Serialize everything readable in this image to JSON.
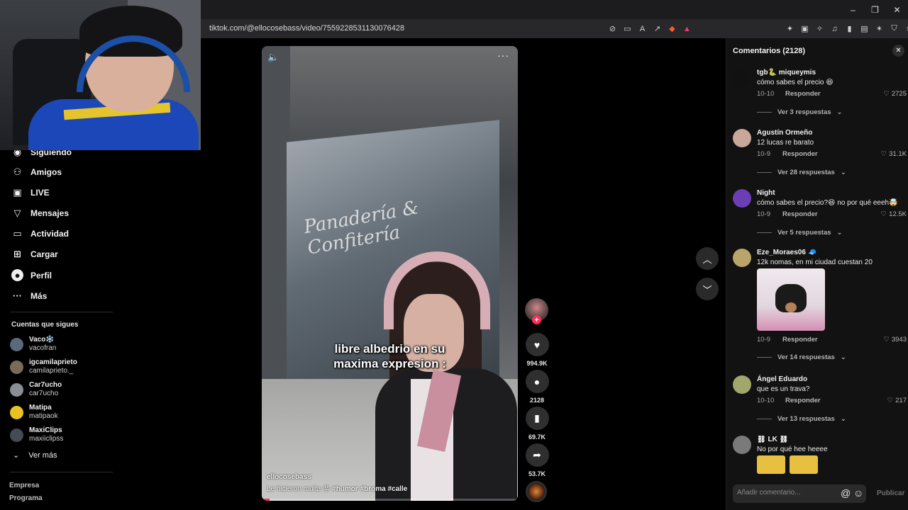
{
  "browser": {
    "url": "tiktok.com/@ellocosebass/video/7559228531130076428",
    "window_controls": {
      "minimize": "–",
      "restore": "❐",
      "close": "✕"
    }
  },
  "sidebar": {
    "nav": [
      {
        "label": "Siguiendo",
        "icon": "following-icon"
      },
      {
        "label": "Amigos",
        "icon": "friends-icon"
      },
      {
        "label": "LIVE",
        "icon": "live-icon"
      },
      {
        "label": "Mensajes",
        "icon": "messages-icon"
      },
      {
        "label": "Actividad",
        "icon": "activity-icon"
      },
      {
        "label": "Cargar",
        "icon": "upload-icon"
      },
      {
        "label": "Perfil",
        "icon": "profile-icon"
      },
      {
        "label": "Más",
        "icon": "more-icon"
      }
    ],
    "following_title": "Cuentas que sigues",
    "following": [
      {
        "name": "Vaco❄️",
        "user": "vacofran",
        "color": "#5a6a7a"
      },
      {
        "name": "igcamilaprieto",
        "user": "camilaprieto._",
        "color": "#7a6a5a"
      },
      {
        "name": "Car7ucho",
        "user": "car7ucho",
        "color": "#8a8f96"
      },
      {
        "name": "Matipa",
        "user": "matipaok",
        "color": "#e8c21e"
      },
      {
        "name": "MaxiClips",
        "user": "maxiiclipss",
        "color": "#444b55"
      }
    ],
    "see_more": "Ver más",
    "footer": [
      "Empresa",
      "Programa"
    ]
  },
  "video": {
    "caption_line1": "libre albedrio en su",
    "caption_line2": "maxima expresion :",
    "author": "ellocosebass",
    "description": "Le hicieron multa 😡",
    "hashtags": [
      "#humor",
      "#broma",
      "#calle"
    ],
    "progress": 0.03
  },
  "actions": {
    "likes": "994.9K",
    "comments": "2128",
    "saves": "69.7K",
    "shares": "53.7K"
  },
  "comments_panel": {
    "title": "Comentarios (2128)",
    "reply_label": "Responder",
    "items": [
      {
        "name": "tgb🐍 miqueymis",
        "text": "cómo sabes el precio 😆",
        "date": "10-10",
        "likes": "2725",
        "replies": "Ver 3 respuestas",
        "avatar": "#111111"
      },
      {
        "name": "Agustín Ormeño",
        "text": "12 lucas re barato",
        "date": "10-9",
        "likes": "31.1K",
        "replies": "Ver 28 respuestas",
        "avatar": "#c9a89a"
      },
      {
        "name": "Night",
        "text": "cómo sabes el precio?😆 no por qué eeeh🤯",
        "date": "10-9",
        "likes": "12.5K",
        "replies": "Ver 5 respuestas",
        "avatar": "#6b3fb3"
      },
      {
        "name": "Eze_Moraes06 🧢",
        "text": "12k nomas, en mi ciudad cuestan 20",
        "date": "10-9",
        "likes": "3943",
        "replies": "Ver 14 respuestas",
        "avatar": "#b9a46a"
      },
      {
        "name": "Ángel Eduardo",
        "text": "que es un trava?",
        "date": "10-10",
        "likes": "217",
        "replies": "Ver 13 respuestas",
        "avatar": "#9fa86a"
      },
      {
        "name": "⛓ LK ⛓",
        "text": "No por qué hee heeee",
        "avatar": "#7a7a7a"
      }
    ],
    "input_placeholder": "Añadir comentario...",
    "publish": "Publicar"
  }
}
